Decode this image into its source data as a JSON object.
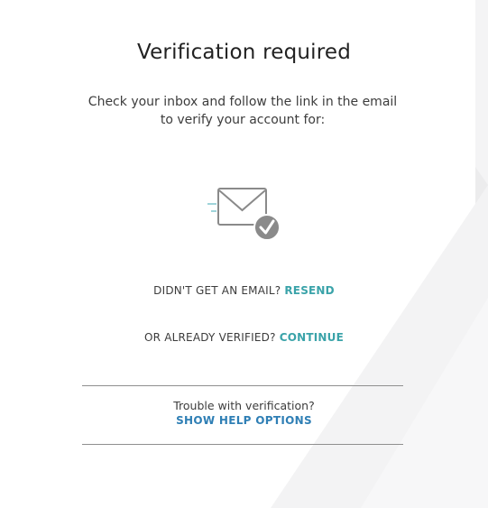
{
  "page": {
    "title": "Verification required",
    "subtitle": "Check your inbox and follow the link in the email to verify your account for:"
  },
  "illustration": {
    "icon": "envelope-check-icon"
  },
  "resend": {
    "prompt": "DIDN'T GET AN EMAIL?",
    "link": "RESEND"
  },
  "continue": {
    "prompt": "OR ALREADY VERIFIED?",
    "link": "CONTINUE"
  },
  "help": {
    "prompt": "Trouble with verification?",
    "link": "SHOW HELP OPTIONS"
  },
  "colors": {
    "accent_teal": "#3aa3a9",
    "help_link_blue": "#2f7fb5",
    "text": "#3c3c3c",
    "background_shape": "#f1f1f2"
  }
}
